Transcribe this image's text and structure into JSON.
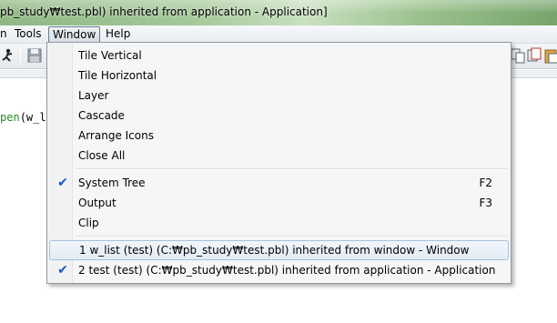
{
  "window": {
    "title": "pb_study₩test.pbl) inherited from application - Application]"
  },
  "menubar": {
    "items": [
      {
        "label": "n"
      },
      {
        "label": "Tools"
      },
      {
        "label": "Window"
      },
      {
        "label": "Help"
      }
    ]
  },
  "editor": {
    "code_prefix": "pen",
    "code_rest": "(w_list"
  },
  "window_menu": {
    "arrange": [
      {
        "label": "Tile Vertical"
      },
      {
        "label": "Tile Horizontal"
      },
      {
        "label": "Layer"
      },
      {
        "label": "Cascade"
      },
      {
        "label": "Arrange Icons"
      },
      {
        "label": "Close All"
      }
    ],
    "panes": [
      {
        "label": "System Tree",
        "shortcut": "F2",
        "checked": true
      },
      {
        "label": "Output",
        "shortcut": "F3",
        "checked": false
      },
      {
        "label": "Clip",
        "shortcut": "",
        "checked": false
      }
    ],
    "windows": [
      {
        "label": "1 w_list (test) (C:₩pb_study₩test.pbl) inherited from window - Window",
        "checked": false,
        "highlighted": true
      },
      {
        "label": "2 test (test) (C:₩pb_study₩test.pbl) inherited from application - Application",
        "checked": true,
        "highlighted": false
      }
    ],
    "check_glyph": "✔"
  },
  "colors": {
    "checkmark": "#1c54c8",
    "code_keyword": "#228b22"
  }
}
